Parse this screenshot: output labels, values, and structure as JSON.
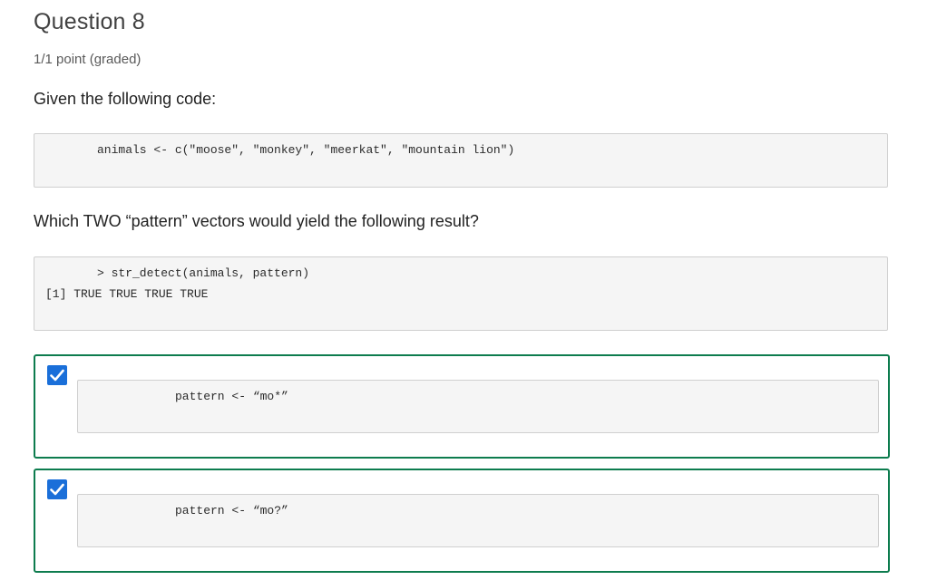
{
  "question": {
    "title": "Question 8",
    "points": "1/1 point (graded)",
    "prompt_intro": "Given the following code:",
    "code_given": "animals <- c(\"moose\", \"monkey\", \"meerkat\", \"mountain lion\")",
    "prompt_which": "Which TWO “pattern” vectors would yield the following result?",
    "result_line_1": "> str_detect(animals, pattern)",
    "result_line_2": "[1] TRUE TRUE TRUE TRUE"
  },
  "answers": [
    {
      "code": "pattern <- “mo*”",
      "checked": true
    },
    {
      "code": "pattern <- “mo?”",
      "checked": true
    }
  ],
  "colors": {
    "correct_border": "#0d7c4e",
    "checkbox_fill": "#1a6fd9",
    "code_background": "#f5f5f5"
  }
}
